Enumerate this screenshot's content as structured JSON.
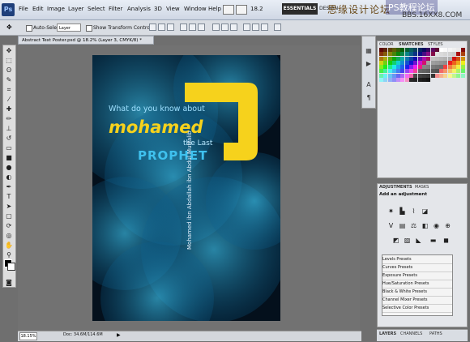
{
  "app": {
    "logo": "Ps",
    "zoom_combo": "18.2"
  },
  "menu": [
    "File",
    "Edit",
    "Image",
    "Layer",
    "Select",
    "Filter",
    "Analysis",
    "3D",
    "View",
    "Window",
    "Help"
  ],
  "workspace": {
    "essentials": "ESSENTIALS",
    "design": "DESIGN",
    "painting": "PAINTING"
  },
  "watermark": {
    "line1": "思缘设计论坛",
    "line2": "PS教程论坛",
    "line3": "BBS.16XX8.COM"
  },
  "options_bar": {
    "auto_select": "Auto-Select:",
    "auto_select_value": "Layer",
    "show_transform": "Show Transform Controls"
  },
  "document": {
    "tab_title": "Abstract Text Poster.psd @ 18.2% (Layer 3, CMYK/8) *",
    "zoom": "18.15%",
    "doc_info": "Doc: 34.6M/114.6M"
  },
  "poster": {
    "line1": "What do you know about",
    "line2": "mohamed",
    "line3": "the Last",
    "line4": "PROPHET",
    "vertical": "Mohamed ibn Abdallah ibn Abdul Muttalib"
  },
  "panels": {
    "swatches_tabs": [
      "COLOR",
      "SWATCHES",
      "STYLES"
    ],
    "adjust_tabs": [
      "ADJUSTMENTS",
      "MASKS"
    ],
    "add_adjustment": "Add an adjustment",
    "presets": [
      "Levels Presets",
      "Curves Presets",
      "Exposure Presets",
      "Hue/Saturation Presets",
      "Black & White Presets",
      "Channel Mixer Presets",
      "Selective Color Presets"
    ],
    "layer_tabs": [
      "LAYERS",
      "CHANNELS",
      "PATHS"
    ]
  },
  "colors": {
    "poster_blue": "#19a9d8",
    "poster_yellow": "#f6d21c",
    "background": "#04101c"
  }
}
